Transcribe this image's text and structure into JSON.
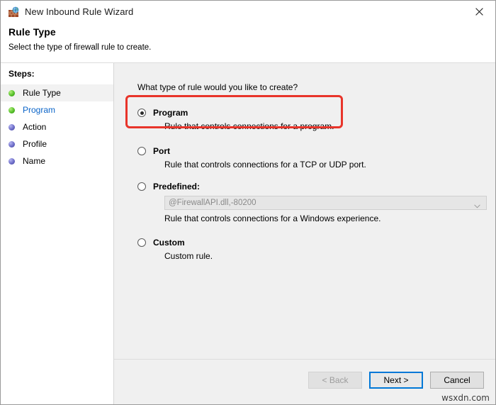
{
  "window": {
    "title": "New Inbound Rule Wizard",
    "icon": "firewall-brick-globe-icon",
    "close_label": "✕"
  },
  "header": {
    "title": "Rule Type",
    "subtitle": "Select the type of firewall rule to create."
  },
  "sidebar": {
    "heading": "Steps:",
    "items": [
      {
        "label": "Rule Type",
        "bullet": "green",
        "state": "current"
      },
      {
        "label": "Program",
        "bullet": "green",
        "state": "link"
      },
      {
        "label": "Action",
        "bullet": "blue",
        "state": "pending"
      },
      {
        "label": "Profile",
        "bullet": "blue",
        "state": "pending"
      },
      {
        "label": "Name",
        "bullet": "blue",
        "state": "pending"
      }
    ]
  },
  "main": {
    "question": "What type of rule would you like to create?",
    "options": [
      {
        "label": "Program",
        "description": "Rule that controls connections for a program.",
        "selected": true
      },
      {
        "label": "Port",
        "description": "Rule that controls connections for a TCP or UDP port.",
        "selected": false
      },
      {
        "label": "Predefined:",
        "description": "Rule that controls connections for a Windows experience.",
        "selected": false,
        "combo_value": "@FirewallAPI.dll,-80200",
        "combo_disabled": true
      },
      {
        "label": "Custom",
        "description": "Custom rule.",
        "selected": false
      }
    ]
  },
  "footer": {
    "back_label": "< Back",
    "next_label": "Next >",
    "cancel_label": "Cancel"
  },
  "watermark": "wsxdn.com",
  "colors": {
    "annotation_red": "#e8342a",
    "accent_blue": "#0078d7",
    "link_blue": "#0a64c8",
    "content_bg": "#f0f0f0",
    "step_green": "#56c02a",
    "step_blue": "#6d6dc8"
  }
}
